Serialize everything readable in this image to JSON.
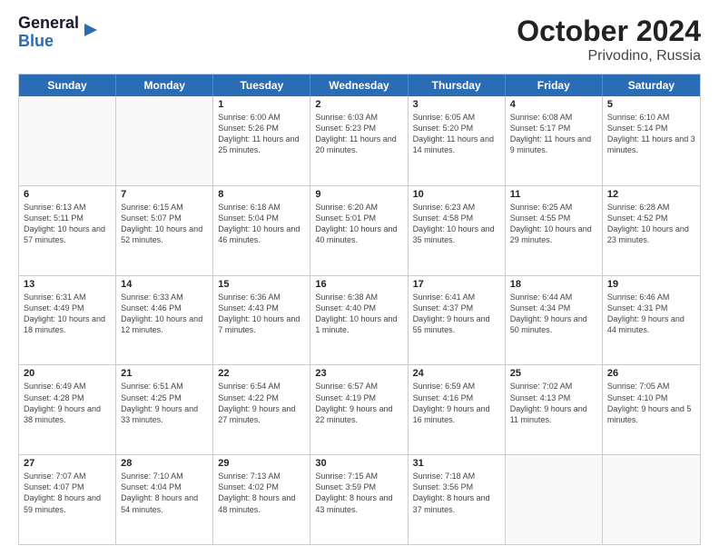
{
  "header": {
    "logo_general": "General",
    "logo_blue": "Blue",
    "title": "October 2024",
    "subtitle": "Privodino, Russia"
  },
  "days_of_week": [
    "Sunday",
    "Monday",
    "Tuesday",
    "Wednesday",
    "Thursday",
    "Friday",
    "Saturday"
  ],
  "weeks": [
    [
      {
        "date": "",
        "info": ""
      },
      {
        "date": "",
        "info": ""
      },
      {
        "date": "1",
        "info": "Sunrise: 6:00 AM\nSunset: 5:26 PM\nDaylight: 11 hours and 25 minutes."
      },
      {
        "date": "2",
        "info": "Sunrise: 6:03 AM\nSunset: 5:23 PM\nDaylight: 11 hours and 20 minutes."
      },
      {
        "date": "3",
        "info": "Sunrise: 6:05 AM\nSunset: 5:20 PM\nDaylight: 11 hours and 14 minutes."
      },
      {
        "date": "4",
        "info": "Sunrise: 6:08 AM\nSunset: 5:17 PM\nDaylight: 11 hours and 9 minutes."
      },
      {
        "date": "5",
        "info": "Sunrise: 6:10 AM\nSunset: 5:14 PM\nDaylight: 11 hours and 3 minutes."
      }
    ],
    [
      {
        "date": "6",
        "info": "Sunrise: 6:13 AM\nSunset: 5:11 PM\nDaylight: 10 hours and 57 minutes."
      },
      {
        "date": "7",
        "info": "Sunrise: 6:15 AM\nSunset: 5:07 PM\nDaylight: 10 hours and 52 minutes."
      },
      {
        "date": "8",
        "info": "Sunrise: 6:18 AM\nSunset: 5:04 PM\nDaylight: 10 hours and 46 minutes."
      },
      {
        "date": "9",
        "info": "Sunrise: 6:20 AM\nSunset: 5:01 PM\nDaylight: 10 hours and 40 minutes."
      },
      {
        "date": "10",
        "info": "Sunrise: 6:23 AM\nSunset: 4:58 PM\nDaylight: 10 hours and 35 minutes."
      },
      {
        "date": "11",
        "info": "Sunrise: 6:25 AM\nSunset: 4:55 PM\nDaylight: 10 hours and 29 minutes."
      },
      {
        "date": "12",
        "info": "Sunrise: 6:28 AM\nSunset: 4:52 PM\nDaylight: 10 hours and 23 minutes."
      }
    ],
    [
      {
        "date": "13",
        "info": "Sunrise: 6:31 AM\nSunset: 4:49 PM\nDaylight: 10 hours and 18 minutes."
      },
      {
        "date": "14",
        "info": "Sunrise: 6:33 AM\nSunset: 4:46 PM\nDaylight: 10 hours and 12 minutes."
      },
      {
        "date": "15",
        "info": "Sunrise: 6:36 AM\nSunset: 4:43 PM\nDaylight: 10 hours and 7 minutes."
      },
      {
        "date": "16",
        "info": "Sunrise: 6:38 AM\nSunset: 4:40 PM\nDaylight: 10 hours and 1 minute."
      },
      {
        "date": "17",
        "info": "Sunrise: 6:41 AM\nSunset: 4:37 PM\nDaylight: 9 hours and 55 minutes."
      },
      {
        "date": "18",
        "info": "Sunrise: 6:44 AM\nSunset: 4:34 PM\nDaylight: 9 hours and 50 minutes."
      },
      {
        "date": "19",
        "info": "Sunrise: 6:46 AM\nSunset: 4:31 PM\nDaylight: 9 hours and 44 minutes."
      }
    ],
    [
      {
        "date": "20",
        "info": "Sunrise: 6:49 AM\nSunset: 4:28 PM\nDaylight: 9 hours and 38 minutes."
      },
      {
        "date": "21",
        "info": "Sunrise: 6:51 AM\nSunset: 4:25 PM\nDaylight: 9 hours and 33 minutes."
      },
      {
        "date": "22",
        "info": "Sunrise: 6:54 AM\nSunset: 4:22 PM\nDaylight: 9 hours and 27 minutes."
      },
      {
        "date": "23",
        "info": "Sunrise: 6:57 AM\nSunset: 4:19 PM\nDaylight: 9 hours and 22 minutes."
      },
      {
        "date": "24",
        "info": "Sunrise: 6:59 AM\nSunset: 4:16 PM\nDaylight: 9 hours and 16 minutes."
      },
      {
        "date": "25",
        "info": "Sunrise: 7:02 AM\nSunset: 4:13 PM\nDaylight: 9 hours and 11 minutes."
      },
      {
        "date": "26",
        "info": "Sunrise: 7:05 AM\nSunset: 4:10 PM\nDaylight: 9 hours and 5 minutes."
      }
    ],
    [
      {
        "date": "27",
        "info": "Sunrise: 7:07 AM\nSunset: 4:07 PM\nDaylight: 8 hours and 59 minutes."
      },
      {
        "date": "28",
        "info": "Sunrise: 7:10 AM\nSunset: 4:04 PM\nDaylight: 8 hours and 54 minutes."
      },
      {
        "date": "29",
        "info": "Sunrise: 7:13 AM\nSunset: 4:02 PM\nDaylight: 8 hours and 48 minutes."
      },
      {
        "date": "30",
        "info": "Sunrise: 7:15 AM\nSunset: 3:59 PM\nDaylight: 8 hours and 43 minutes."
      },
      {
        "date": "31",
        "info": "Sunrise: 7:18 AM\nSunset: 3:56 PM\nDaylight: 8 hours and 37 minutes."
      },
      {
        "date": "",
        "info": ""
      },
      {
        "date": "",
        "info": ""
      }
    ]
  ]
}
